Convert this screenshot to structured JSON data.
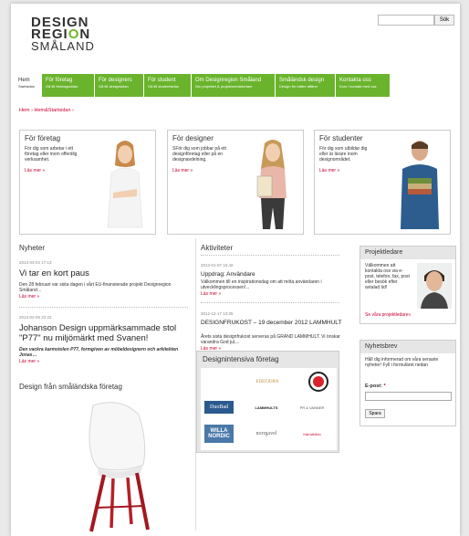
{
  "logo": {
    "line1": "DESIGN",
    "line2_a": "REGI",
    "line2_o": "O",
    "line2_b": "N",
    "line3": "SMÅLAND"
  },
  "search": {
    "placeholder": "",
    "button": "Sök"
  },
  "nav": [
    {
      "title": "Hem",
      "sub": "Startsidan"
    },
    {
      "title": "För företag",
      "sub": "Gå till företagssidan"
    },
    {
      "title": "För designers",
      "sub": "Gå till designsidan"
    },
    {
      "title": "För student",
      "sub": "Gå till studentsidan"
    },
    {
      "title": "Om Designregion Småland",
      "sub": "Om projektet & projektmedarbetare"
    },
    {
      "title": "Småländsk design",
      "sub": "Design för bättre affärer"
    },
    {
      "title": "Kontakta oss",
      "sub": "Kom i kontakt med oss"
    }
  ],
  "breadcrumb": "Hem › Hem&Startsidan ›",
  "boxes": [
    {
      "title": "För företag",
      "text": "För dig som arbetar i ett företag eller inom offentlig verksamhet.",
      "more": "Läs mer »"
    },
    {
      "title": "För designer",
      "text": "SFör dig som jobbar på ett designföretag eller på en designavdelning.",
      "more": "Läs mer »"
    },
    {
      "title": "För studenter",
      "text": "För dig som utbildar dig eller är lärare inom designområdet.",
      "more": "Läs mer »"
    }
  ],
  "news": {
    "title": "Nyheter",
    "items": [
      {
        "date": "2013-03-04 17:13",
        "heading": "Vi tar en kort paus",
        "text": "Den 28 februari var sista dagen i vårt EU-finansierade projekt Designregion Småland…",
        "more": "Läs mer »"
      },
      {
        "date": "2013-02-05 22:22",
        "heading": "Johanson Design uppmärksammade stol \"P77\" nu miljömärkt med Svanen!",
        "text": "Den vackra karmstolen P77, formgiven av möbeldesignern och arkitekten Jonas…",
        "more": "Läs mer »"
      }
    ],
    "design_title": "Design från småländska företag"
  },
  "activities": {
    "title": "Aktiviteter",
    "items": [
      {
        "date": "2013-01-07 15:40",
        "heading": "Uppdrag: Användare",
        "text": "Välkommen till en inspirationsdag om att möta användaren i utvecklingsprocessen!...",
        "more": "Läs mer »"
      },
      {
        "date": "2012-12-17 13:35",
        "heading": "DESIGNFRUKOST – 19 december 2012 LAMMHULT",
        "text": "Årets sista designfrukost serveras på GRAND LAMMHULT. Vi önskar varandra God jul,...",
        "more": "Läs mer »"
      }
    ]
  },
  "companies": {
    "title": "Designintensiva företag",
    "logos": [
      "EDEFJORN",
      "ANDRÉ",
      "DuoBad",
      "LAMMHULTS",
      "PR & VANNER",
      "WILLA NORDIC",
      "norrgavel",
      "Kärrutbildn"
    ]
  },
  "project": {
    "title": "Projektledare",
    "text": "Välkommen att kontakta oss via e-post, telefon, fax, post eller besök efter avtalad tid!",
    "link": "Se våra projektledare»"
  },
  "newsletter": {
    "title": "Nyhetsbrev",
    "text": "Håll dig informerad om våra senaste nyheter! Fyll i formuläret nedan",
    "email_label": "E-post:",
    "required": "*",
    "button": "Spara"
  },
  "colors": {
    "nav_green": "#6ab42d",
    "link_red": "#cc0033",
    "logo_green": "#6fb62c"
  }
}
